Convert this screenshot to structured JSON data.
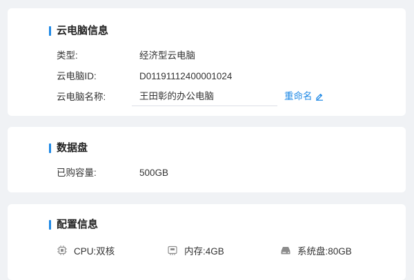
{
  "info": {
    "title": "云电脑信息",
    "type_label": "类型:",
    "type_value": "经济型云电脑",
    "id_label": "云电脑ID:",
    "id_value": "D01191112400001024",
    "name_label": "云电脑名称:",
    "name_value": "王田彰的办公电脑",
    "rename_label": "重命名"
  },
  "disk": {
    "title": "数据盘",
    "purchased_label": "已购容量:",
    "purchased_value": "500GB"
  },
  "config": {
    "title": "配置信息",
    "cpu": "CPU:双核",
    "memory": "内存:4GB",
    "system_disk": "系统盘:80GB"
  },
  "icons": {
    "rename": "pencil-icon",
    "cpu": "cpu-chip-icon",
    "memory": "memory-icon",
    "system_disk": "hard-disk-icon"
  },
  "colors": {
    "accent": "#1e88e5",
    "icon_gray": "#8c8c8c",
    "background": "#f0f2f5"
  }
}
